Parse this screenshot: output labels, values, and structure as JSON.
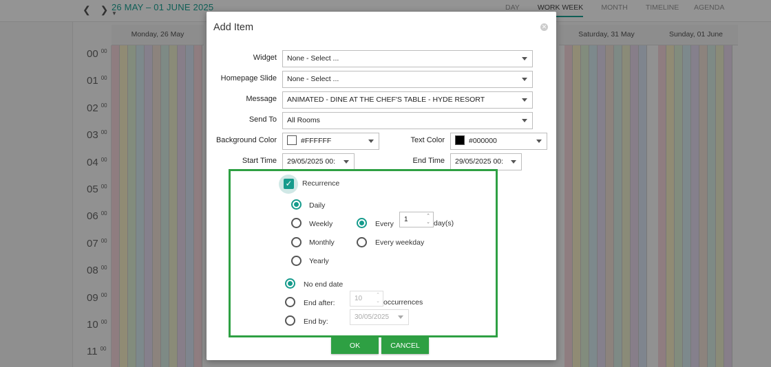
{
  "calendar": {
    "date_range": "26 MAY – 01 JUNE 2025",
    "views": [
      "DAY",
      "WORK WEEK",
      "MONTH",
      "TIMELINE",
      "AGENDA"
    ],
    "active_view": "WORK WEEK",
    "day_headers": [
      "Monday, 26 May",
      "Saturday, 31 May",
      "Sunday, 01 June"
    ],
    "hours": [
      "00",
      "01",
      "02",
      "03",
      "04",
      "05",
      "06",
      "07",
      "08",
      "09",
      "10",
      "11"
    ],
    "minutes": "00"
  },
  "dialog": {
    "title": "Add Item",
    "fields": {
      "widget": {
        "label": "Widget",
        "value": "None - Select ..."
      },
      "homepage_slide": {
        "label": "Homepage Slide",
        "value": "None - Select ..."
      },
      "message": {
        "label": "Message",
        "value": "ANIMATED - DINE AT THE CHEF'S TABLE - HYDE RESORT"
      },
      "send_to": {
        "label": "Send To",
        "value": "All Rooms"
      },
      "background_color": {
        "label": "Background Color",
        "value": "#FFFFFF",
        "swatch": "#FFFFFF"
      },
      "text_color": {
        "label": "Text Color",
        "value": "#000000",
        "swatch": "#000000"
      },
      "start_time": {
        "label": "Start Time",
        "value": "29/05/2025 00:"
      },
      "end_time": {
        "label": "End Time",
        "value": "29/05/2025 00:"
      }
    },
    "recurrence": {
      "label": "Recurrence",
      "checked": true,
      "patterns": [
        "Daily",
        "Weekly",
        "Monthly",
        "Yearly"
      ],
      "selected_pattern": "Daily",
      "every_label": "Every",
      "every_value": "1",
      "every_unit": "day(s)",
      "every_weekday_label": "Every weekday",
      "end_options": {
        "no_end": "No end date",
        "end_after": "End after:",
        "end_after_value": "10",
        "occurrences": "occurrences",
        "end_by": "End by:",
        "end_by_value": "30/05/2025"
      }
    },
    "buttons": {
      "ok": "OK",
      "cancel": "CANCEL"
    }
  },
  "colors": {
    "accent": "#169b8c",
    "highlight": "#2ea043"
  }
}
